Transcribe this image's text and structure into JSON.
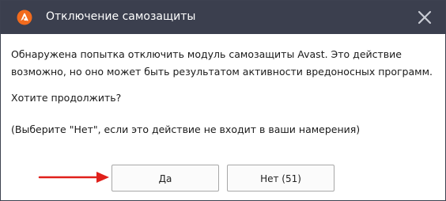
{
  "window": {
    "title": "Отключение самозащиты",
    "logo_icon": "avast-logo-icon",
    "close_icon": "close-x-icon"
  },
  "message": {
    "line1": "Обнаружена попытка отключить модуль самозащиты Avast. Это действие",
    "line2": "возможно, но оно может быть результатом активности вредоносных программ.",
    "question": "Хотите продолжить?",
    "hint": "(Выберите \"Нет\", если это действие не входит в ваши намерения)"
  },
  "buttons": {
    "yes_label": "Да",
    "no_label": "Нет (51)"
  },
  "annotation": {
    "arrow_icon": "red-arrow-icon",
    "arrow_color": "#e0201b"
  },
  "colors": {
    "titlebar": "#3b3f4e",
    "brand_orange": "#f26b1d"
  }
}
